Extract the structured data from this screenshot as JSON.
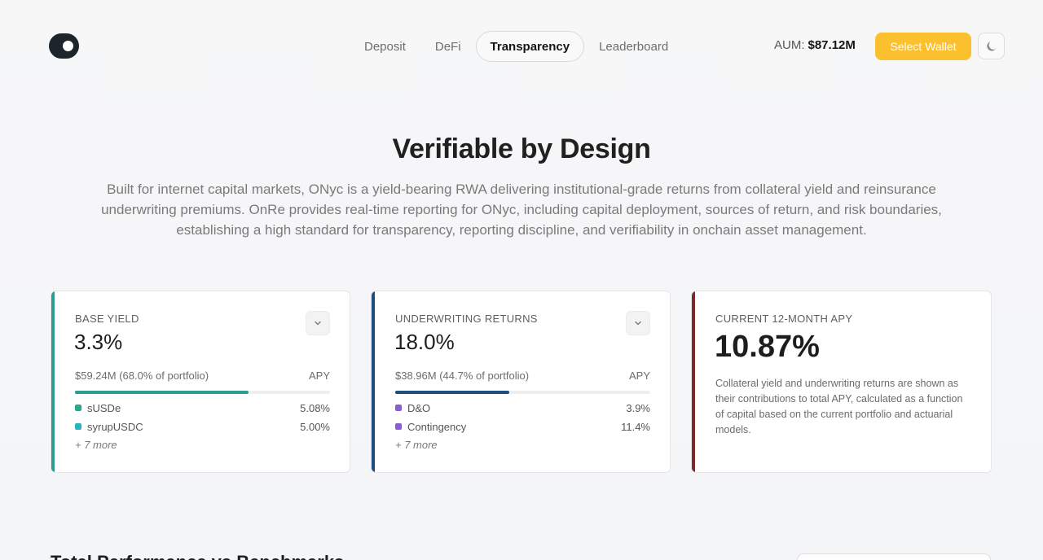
{
  "header": {
    "nav": [
      {
        "label": "Deposit",
        "active": false
      },
      {
        "label": "DeFi",
        "active": false
      },
      {
        "label": "Transparency",
        "active": true
      },
      {
        "label": "Leaderboard",
        "active": false
      }
    ],
    "aum_label": "AUM:",
    "aum_value": "$87.12M",
    "wallet_button": "Select Wallet",
    "theme_icon": "moon-icon"
  },
  "hero": {
    "title": "Verifiable by Design",
    "description": "Built for internet capital markets, ONyc is a yield-bearing RWA delivering institutional-grade returns from collateral yield and reinsurance underwriting premiums. OnRe provides real-time reporting for ONyc, including capital deployment, sources of return, and risk boundaries, establishing a high standard for transparency, reporting discipline, and verifiability in onchain asset management."
  },
  "cards": {
    "base_yield": {
      "label": "BASE YIELD",
      "value": "3.3%",
      "allocation": "$59.24M (68.0% of portfolio)",
      "unit": "APY",
      "portfolio_fraction": 0.68,
      "accent": "#2a9d8f",
      "items": [
        {
          "name": "sUSDe",
          "pct": "5.08%",
          "color": "#2aa889"
        },
        {
          "name": "syrupUSDC",
          "pct": "5.00%",
          "color": "#2bb3c4"
        }
      ],
      "more": "+ 7 more"
    },
    "underwriting": {
      "label": "UNDERWRITING RETURNS",
      "value": "18.0%",
      "allocation": "$38.96M (44.7% of portfolio)",
      "unit": "APY",
      "portfolio_fraction": 0.447,
      "accent": "#1d4f7c",
      "items": [
        {
          "name": "D&O",
          "pct": "3.9%",
          "color": "#8a5cd6"
        },
        {
          "name": "Contingency",
          "pct": "11.4%",
          "color": "#8a5cd6"
        }
      ],
      "more": "+ 7 more"
    },
    "apy": {
      "label": "CURRENT 12-MONTH APY",
      "value": "10.87%",
      "accent": "#7a2a2e",
      "note": "Collateral yield and underwriting returns are shown as their contributions to total APY, calculated as a function of capital based on the current portfolio and actuarial models."
    }
  },
  "section": {
    "title": "Total Performance vs Benchmarks"
  }
}
